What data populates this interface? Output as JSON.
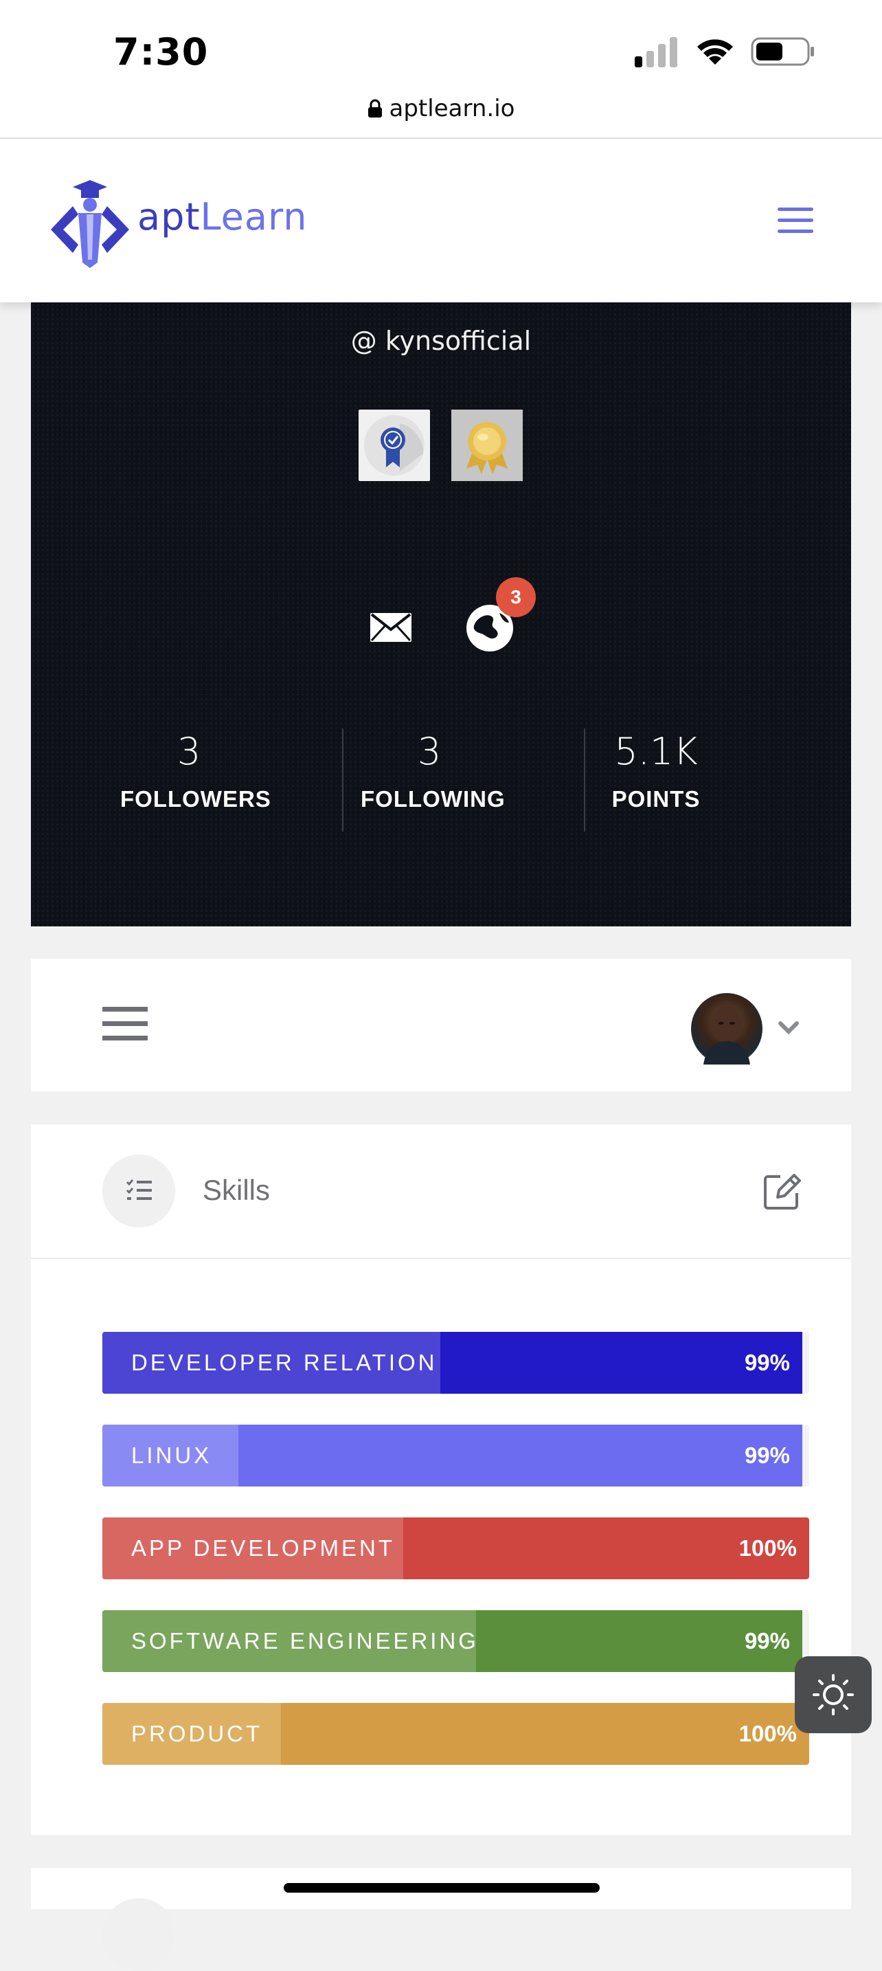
{
  "status_bar": {
    "time": "7:30"
  },
  "browser": {
    "url": "aptlearn.io"
  },
  "site_header": {
    "logo_text_part1": "apt",
    "logo_text_part2": "Learn",
    "accent_color": "#6a6fe2"
  },
  "profile": {
    "username": "@ kynsofficial",
    "notification_count": "3",
    "stats": [
      {
        "value": "3",
        "label": "FOLLOWERS"
      },
      {
        "value": "3",
        "label": "FOLLOWING"
      },
      {
        "value": "5.1K",
        "label": "POINTS"
      }
    ],
    "icons": [
      "ribbon-badge-icon",
      "gold-medal-badge-icon",
      "mail-icon",
      "globe-icon"
    ]
  },
  "skills": {
    "title": "Skills",
    "items": [
      {
        "name": "DEVELOPER RELATION",
        "percent": "99%",
        "fraction": 0.99,
        "color": "#2219c7",
        "label_color": "#4c44d3"
      },
      {
        "name": "LINUX",
        "percent": "99%",
        "fraction": 0.99,
        "color": "#6b6cf0",
        "label_color": "#8a8af4"
      },
      {
        "name": "APP DEVELOPMENT",
        "percent": "100%",
        "fraction": 1.0,
        "color": "#cf4540",
        "label_color": "#d96761"
      },
      {
        "name": "SOFTWARE ENGINEERING",
        "percent": "99%",
        "fraction": 0.99,
        "color": "#5c8f3c",
        "label_color": "#79a55c"
      },
      {
        "name": "PRODUCT",
        "percent": "100%",
        "fraction": 1.0,
        "color": "#d49c44",
        "label_color": "#ddb064"
      }
    ]
  }
}
